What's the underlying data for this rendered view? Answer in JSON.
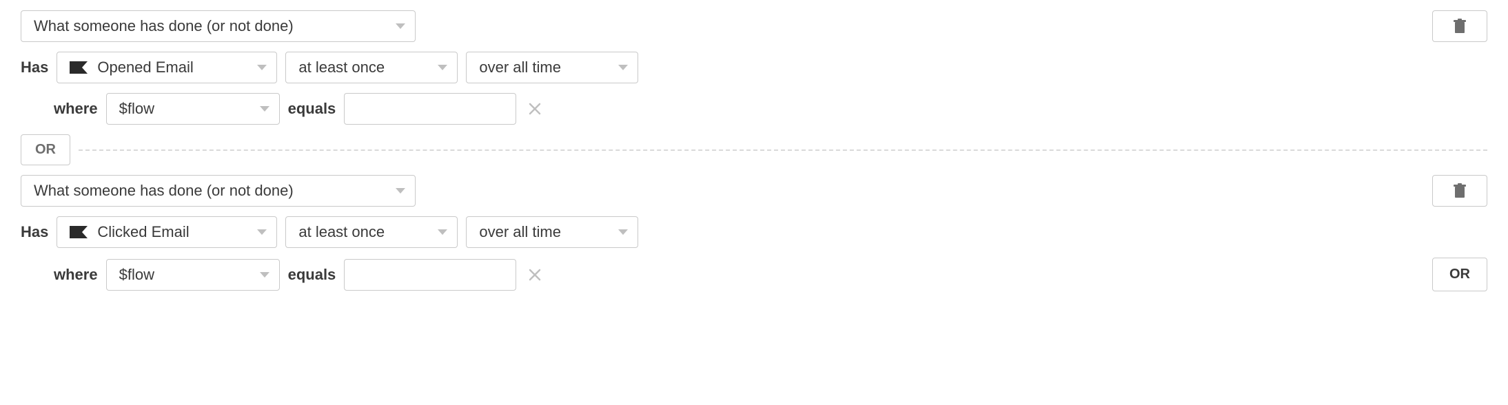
{
  "conditions": [
    {
      "type_label": "What someone has done (or not done)",
      "has_label": "Has",
      "metric": "Opened Email",
      "frequency": "at least once",
      "timeframe": "over all time",
      "where_label": "where",
      "property": "$flow",
      "operator_label": "equals",
      "value": ""
    },
    {
      "type_label": "What someone has done (or not done)",
      "has_label": "Has",
      "metric": "Clicked Email",
      "frequency": "at least once",
      "timeframe": "over all time",
      "where_label": "where",
      "property": "$flow",
      "operator_label": "equals",
      "value": ""
    }
  ],
  "or_label": "OR",
  "add_or_label": "OR"
}
